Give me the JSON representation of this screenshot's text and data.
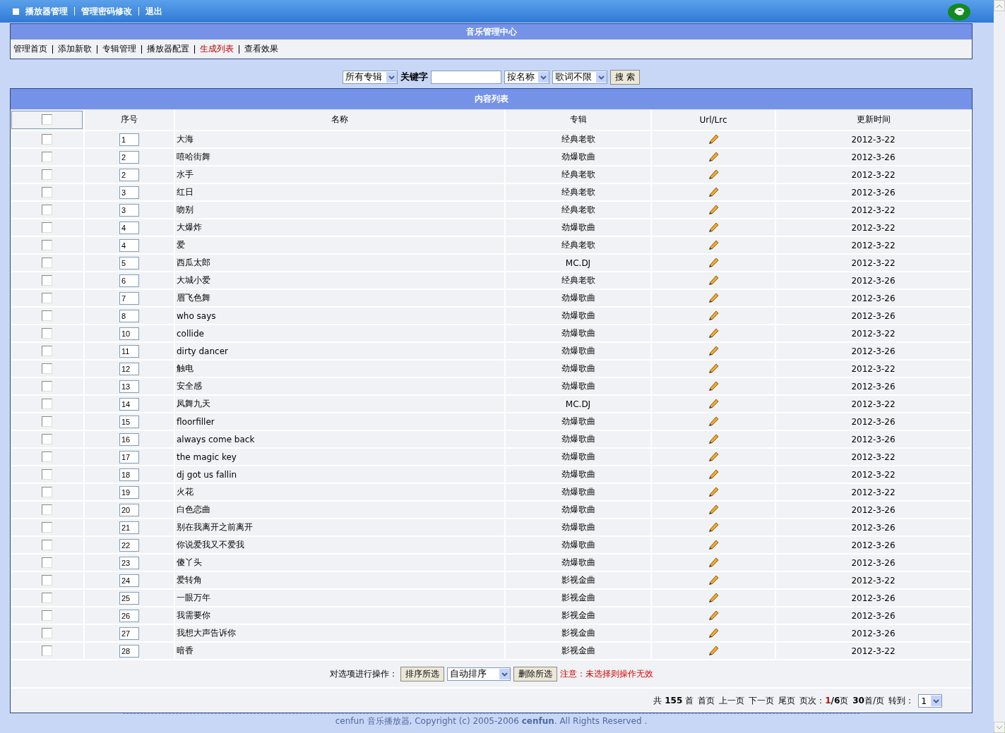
{
  "top_bar": {
    "links": [
      "播放器管理",
      "管理密码修改",
      "退出"
    ]
  },
  "panel": {
    "title": "音乐管理中心",
    "nav": [
      {
        "label": "管理首页",
        "selected": false
      },
      {
        "label": "添加新歌",
        "selected": false
      },
      {
        "label": "专辑管理",
        "selected": false
      },
      {
        "label": "播放器配置",
        "selected": false
      },
      {
        "label": "生成列表",
        "selected": true
      },
      {
        "label": "查看效果",
        "selected": false
      }
    ]
  },
  "search": {
    "album_select": "所有专辑",
    "keyword_label": "关键字",
    "field_select": "按名称",
    "lyrics_select": "歌词不限",
    "button": "搜 索"
  },
  "table": {
    "title": "内容列表",
    "header_checked": false,
    "columns": [
      "序号",
      "名称",
      "专辑",
      "Url/Lrc",
      "更新时间"
    ],
    "rows": [
      {
        "checked": false,
        "order": "1",
        "name": "大海",
        "album": "经典老歌",
        "date": "2012-3-22"
      },
      {
        "checked": false,
        "order": "2",
        "name": "嘻哈街舞",
        "album": "劲爆歌曲",
        "date": "2012-3-26"
      },
      {
        "checked": false,
        "order": "2",
        "name": "水手",
        "album": "经典老歌",
        "date": "2012-3-22"
      },
      {
        "checked": false,
        "order": "3",
        "name": "红日",
        "album": "经典老歌",
        "date": "2012-3-26"
      },
      {
        "checked": false,
        "order": "3",
        "name": "吻别",
        "album": "经典老歌",
        "date": "2012-3-22"
      },
      {
        "checked": false,
        "order": "4",
        "name": "大爆炸",
        "album": "劲爆歌曲",
        "date": "2012-3-22"
      },
      {
        "checked": false,
        "order": "4",
        "name": "爱",
        "album": "经典老歌",
        "date": "2012-3-22"
      },
      {
        "checked": false,
        "order": "5",
        "name": "西瓜太郎",
        "album": "MC.DJ",
        "date": "2012-3-22"
      },
      {
        "checked": false,
        "order": "6",
        "name": "大城小爱",
        "album": "经典老歌",
        "date": "2012-3-26"
      },
      {
        "checked": false,
        "order": "7",
        "name": "眉飞色舞",
        "album": "劲爆歌曲",
        "date": "2012-3-26"
      },
      {
        "checked": false,
        "order": "8",
        "name": "who says",
        "album": "劲爆歌曲",
        "date": "2012-3-26"
      },
      {
        "checked": false,
        "order": "10",
        "name": "collide",
        "album": "劲爆歌曲",
        "date": "2012-3-22"
      },
      {
        "checked": false,
        "order": "11",
        "name": "dirty dancer",
        "album": "劲爆歌曲",
        "date": "2012-3-26"
      },
      {
        "checked": false,
        "order": "12",
        "name": "触电",
        "album": "劲爆歌曲",
        "date": "2012-3-22"
      },
      {
        "checked": false,
        "order": "13",
        "name": "安全感",
        "album": "劲爆歌曲",
        "date": "2012-3-26"
      },
      {
        "checked": false,
        "order": "14",
        "name": "凤舞九天",
        "album": "MC.DJ",
        "date": "2012-3-22"
      },
      {
        "checked": false,
        "order": "15",
        "name": "floorfiller",
        "album": "劲爆歌曲",
        "date": "2012-3-26"
      },
      {
        "checked": false,
        "order": "16",
        "name": "always come back",
        "album": "劲爆歌曲",
        "date": "2012-3-26"
      },
      {
        "checked": false,
        "order": "17",
        "name": "the magic key",
        "album": "劲爆歌曲",
        "date": "2012-3-22"
      },
      {
        "checked": false,
        "order": "18",
        "name": "dj got us fallin",
        "album": "劲爆歌曲",
        "date": "2012-3-22"
      },
      {
        "checked": false,
        "order": "19",
        "name": "火花",
        "album": "劲爆歌曲",
        "date": "2012-3-22"
      },
      {
        "checked": false,
        "order": "20",
        "name": "白色恋曲",
        "album": "劲爆歌曲",
        "date": "2012-3-26"
      },
      {
        "checked": false,
        "order": "21",
        "name": "别在我离开之前离开",
        "album": "劲爆歌曲",
        "date": "2012-3-26"
      },
      {
        "checked": false,
        "order": "22",
        "name": "你说爱我又不爱我",
        "album": "劲爆歌曲",
        "date": "2012-3-26"
      },
      {
        "checked": false,
        "order": "23",
        "name": "傻丫头",
        "album": "劲爆歌曲",
        "date": "2012-3-26"
      },
      {
        "checked": false,
        "order": "24",
        "name": "爱转角",
        "album": "影视金曲",
        "date": "2012-3-22"
      },
      {
        "checked": false,
        "order": "25",
        "name": "一眼万年",
        "album": "影视金曲",
        "date": "2012-3-26"
      },
      {
        "checked": false,
        "order": "26",
        "name": "我需要你",
        "album": "影视金曲",
        "date": "2012-3-26"
      },
      {
        "checked": false,
        "order": "27",
        "name": "我想大声告诉你",
        "album": "影视金曲",
        "date": "2012-3-26"
      },
      {
        "checked": false,
        "order": "28",
        "name": "暗香",
        "album": "影视金曲",
        "date": "2012-3-22"
      }
    ]
  },
  "actions": {
    "label": "对选项进行操作：",
    "sort_button": "排序所选",
    "sort_select": "自动排序",
    "delete_button": "删除所选",
    "warning": "注意：未选择则操作无效"
  },
  "pager": {
    "summary": "共 **155** 首",
    "links": [
      "首页",
      "上一页",
      "下一页",
      "尾页"
    ],
    "page_label": "页次：",
    "current_page": "1",
    "page_total": "**/6**页",
    "per_page": "**30**首/页",
    "goto_label": "转到：",
    "goto_value": "1"
  },
  "footer": "cenfun 音乐播放器, Copyright (c) 2005-2006 **cenfun**. All Rights Reserved ."
}
